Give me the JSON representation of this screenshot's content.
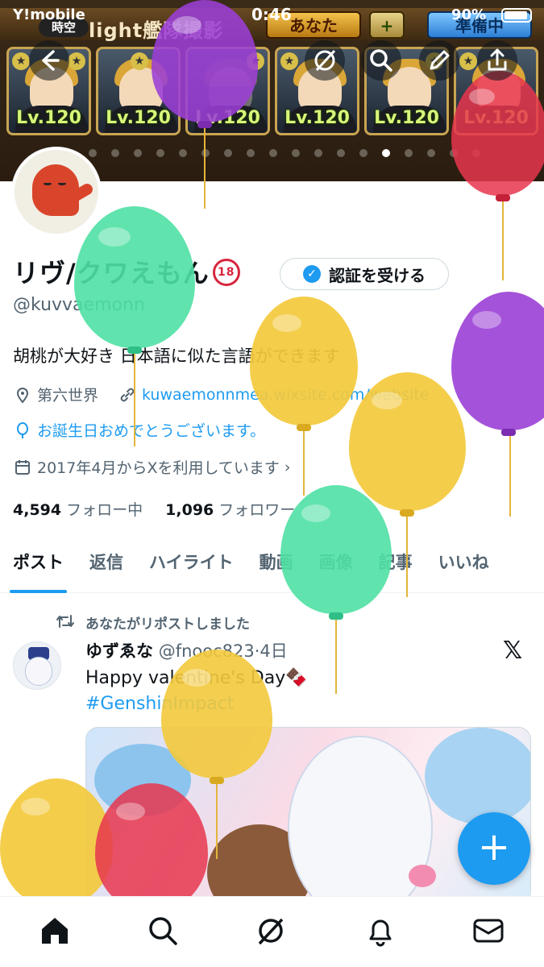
{
  "status_bar": {
    "carrier": "Y!mobile",
    "time": "0:46",
    "battery": "90%"
  },
  "banner": {
    "game_tag": "時空",
    "game_title": "light艦隊撮影",
    "you_button": "あなた",
    "ready_button": "準備中",
    "card_level": "Lv.120"
  },
  "profile": {
    "display_name": "リヴ/クワえもん",
    "age_badge": "18",
    "handle": "@kuvvaemonn",
    "verify_button": "認証を受ける",
    "bio": "胡桃が大好き 日本語に似た言語ができます",
    "location": "第六世界",
    "website": "kuwaemonnmea.wixsite.com/website",
    "birthday_text": "お誕生日おめでとうございます。",
    "joined": "2017年4月からXを利用しています",
    "following_count": "4,594",
    "following_label": "フォロー中",
    "followers_count": "1,096",
    "followers_label": "フォロワー"
  },
  "tabs": [
    "ポスト",
    "返信",
    "ハイライト",
    "動画",
    "画像",
    "記事",
    "いいね"
  ],
  "post": {
    "repost_label": "あなたがリポストしました",
    "author": "ゆずゑな",
    "author_handle": "@fnooc823",
    "time": "4日",
    "text": "Happy valentine's Day",
    "hashtag": "#GenshinImpact"
  },
  "icons": {
    "back": "back-arrow-icon",
    "grok": "grok-icon",
    "search": "search-icon",
    "edit": "pencil-icon",
    "share": "share-icon",
    "home": "home-icon",
    "notifications": "bell-icon",
    "messages": "mail-icon",
    "compose": "plus-icon"
  },
  "colors": {
    "accent": "#1d9bf0",
    "balloon_purple": "#9b3fd6",
    "balloon_red": "#e8364e",
    "balloon_green": "#4fe0a4",
    "balloon_yellow": "#f3c93c"
  }
}
